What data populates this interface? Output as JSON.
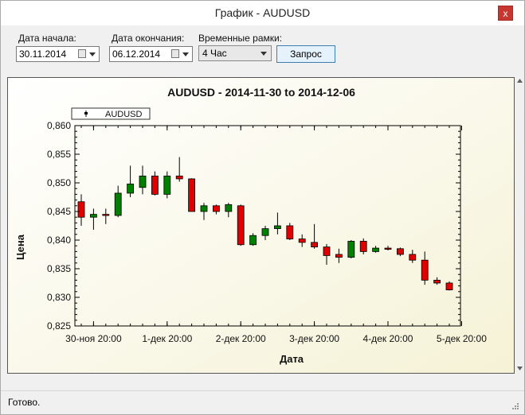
{
  "window": {
    "title": "График - AUDUSD",
    "close_glyph": "x"
  },
  "toolbar": {
    "start_label": "Дата начала:",
    "start_value": "30.11.2014",
    "end_label": "Дата окончания:",
    "end_value": "06.12.2014",
    "timeframe_label": "Временные рамки:",
    "timeframe_value": "4 Час",
    "request_button": "Запрос"
  },
  "status": {
    "text": "Готово."
  },
  "colors": {
    "up": "#008000",
    "down": "#e00000",
    "plot_bg_light": "#ffffff",
    "plot_bg_warm": "#f5f2d6",
    "accent_button": "#e5f1fb",
    "close_button": "#c7372f"
  },
  "chart_data": {
    "type": "candlestick",
    "title": "AUDUSD - 2014-11-30 to 2014-12-06",
    "xlabel": "Дата",
    "ylabel": "Цена",
    "legend": {
      "entries": [
        "AUDUSD"
      ],
      "placement": "top-left"
    },
    "ylim": [
      0.825,
      0.86
    ],
    "yticks": [
      "0,825",
      "0,830",
      "0,835",
      "0,840",
      "0,845",
      "0,850",
      "0,855",
      "0,860"
    ],
    "xticks": [
      "30-ноя 20:00",
      "1-дек 20:00",
      "2-дек 20:00",
      "3-дек 20:00",
      "4-дек 20:00",
      "5-дек 20:00"
    ],
    "grid": false,
    "series": [
      {
        "name": "AUDUSD",
        "candles": [
          {
            "o": 0.8467,
            "h": 0.848,
            "l": 0.8425,
            "c": 0.844
          },
          {
            "o": 0.844,
            "h": 0.8455,
            "l": 0.8418,
            "c": 0.8445
          },
          {
            "o": 0.8445,
            "h": 0.8455,
            "l": 0.8428,
            "c": 0.8443
          },
          {
            "o": 0.8443,
            "h": 0.8495,
            "l": 0.844,
            "c": 0.8482
          },
          {
            "o": 0.8482,
            "h": 0.853,
            "l": 0.8475,
            "c": 0.8498
          },
          {
            "o": 0.8492,
            "h": 0.853,
            "l": 0.848,
            "c": 0.8512
          },
          {
            "o": 0.8512,
            "h": 0.852,
            "l": 0.8478,
            "c": 0.848
          },
          {
            "o": 0.848,
            "h": 0.852,
            "l": 0.8473,
            "c": 0.8512
          },
          {
            "o": 0.8512,
            "h": 0.8545,
            "l": 0.8502,
            "c": 0.8507
          },
          {
            "o": 0.8507,
            "h": 0.8508,
            "l": 0.845,
            "c": 0.845
          },
          {
            "o": 0.845,
            "h": 0.8465,
            "l": 0.8435,
            "c": 0.846
          },
          {
            "o": 0.846,
            "h": 0.8462,
            "l": 0.8445,
            "c": 0.845
          },
          {
            "o": 0.845,
            "h": 0.8465,
            "l": 0.844,
            "c": 0.8462
          },
          {
            "o": 0.846,
            "h": 0.8462,
            "l": 0.839,
            "c": 0.8392
          },
          {
            "o": 0.8392,
            "h": 0.8412,
            "l": 0.839,
            "c": 0.8408
          },
          {
            "o": 0.8408,
            "h": 0.8425,
            "l": 0.84,
            "c": 0.842
          },
          {
            "o": 0.842,
            "h": 0.8448,
            "l": 0.841,
            "c": 0.8425
          },
          {
            "o": 0.8425,
            "h": 0.843,
            "l": 0.84,
            "c": 0.8402
          },
          {
            "o": 0.8402,
            "h": 0.841,
            "l": 0.8388,
            "c": 0.8396
          },
          {
            "o": 0.8396,
            "h": 0.8428,
            "l": 0.8385,
            "c": 0.8388
          },
          {
            "o": 0.8388,
            "h": 0.8393,
            "l": 0.8357,
            "c": 0.8373
          },
          {
            "o": 0.8375,
            "h": 0.8385,
            "l": 0.836,
            "c": 0.837
          },
          {
            "o": 0.837,
            "h": 0.84,
            "l": 0.8368,
            "c": 0.8398
          },
          {
            "o": 0.8398,
            "h": 0.8403,
            "l": 0.8375,
            "c": 0.838
          },
          {
            "o": 0.838,
            "h": 0.839,
            "l": 0.8378,
            "c": 0.8386
          },
          {
            "o": 0.8386,
            "h": 0.839,
            "l": 0.8382,
            "c": 0.8385
          },
          {
            "o": 0.8385,
            "h": 0.8387,
            "l": 0.8372,
            "c": 0.8375
          },
          {
            "o": 0.8375,
            "h": 0.8383,
            "l": 0.836,
            "c": 0.8365
          },
          {
            "o": 0.8365,
            "h": 0.838,
            "l": 0.8322,
            "c": 0.833
          },
          {
            "o": 0.833,
            "h": 0.8335,
            "l": 0.8322,
            "c": 0.8325
          },
          {
            "o": 0.8325,
            "h": 0.8328,
            "l": 0.8312,
            "c": 0.8313
          }
        ]
      }
    ]
  }
}
